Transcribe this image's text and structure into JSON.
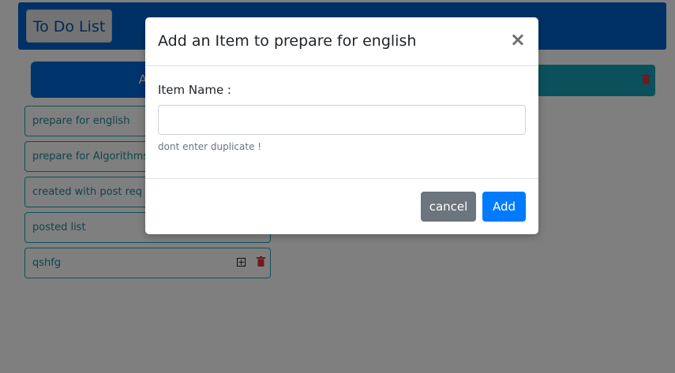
{
  "navbar": {
    "brand_label": "To Do List"
  },
  "add_list": {
    "label": "Add"
  },
  "list_items": [
    {
      "label": "prepare for english"
    },
    {
      "label": "prepare for Algorithms"
    },
    {
      "label": "created with post req"
    },
    {
      "label": "posted list"
    },
    {
      "label": "qshfg"
    }
  ],
  "icons": {
    "trash": "trash-icon",
    "plus": "plus-square-icon",
    "close": "close-icon"
  },
  "colors": {
    "primary": "#007bff",
    "navbar": "#0062cc",
    "teal": "#17a2b8",
    "danger": "#dc3545",
    "secondary": "#6c757d"
  },
  "modal": {
    "title": "Add an Item to prepare for english",
    "close_symbol": "×",
    "field_label": "Item Name :",
    "input_value": "",
    "input_placeholder": "",
    "help_text": "dont enter duplicate !",
    "cancel_label": "cancel",
    "add_label": "Add"
  }
}
